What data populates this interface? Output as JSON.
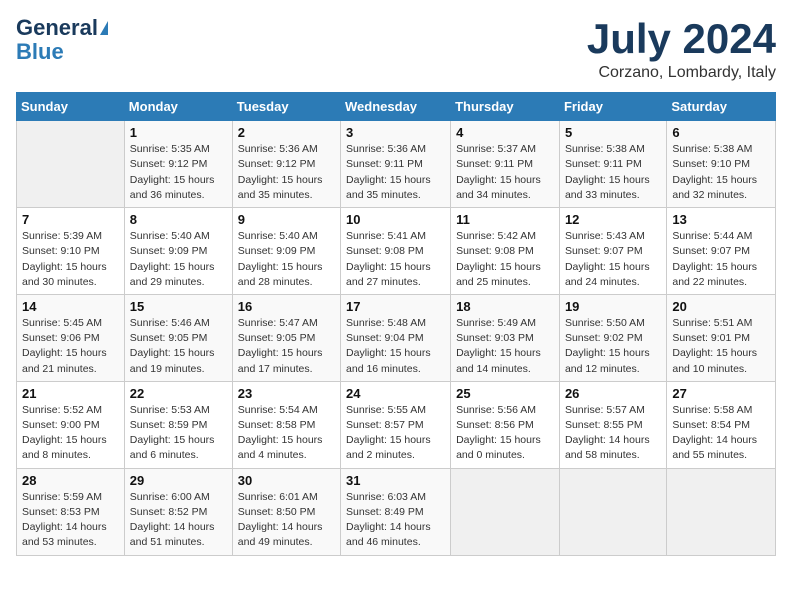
{
  "header": {
    "logo_line1": "General",
    "logo_line2": "Blue",
    "month": "July 2024",
    "location": "Corzano, Lombardy, Italy"
  },
  "weekdays": [
    "Sunday",
    "Monday",
    "Tuesday",
    "Wednesday",
    "Thursday",
    "Friday",
    "Saturday"
  ],
  "weeks": [
    [
      {
        "day": "",
        "info": ""
      },
      {
        "day": "1",
        "info": "Sunrise: 5:35 AM\nSunset: 9:12 PM\nDaylight: 15 hours\nand 36 minutes."
      },
      {
        "day": "2",
        "info": "Sunrise: 5:36 AM\nSunset: 9:12 PM\nDaylight: 15 hours\nand 35 minutes."
      },
      {
        "day": "3",
        "info": "Sunrise: 5:36 AM\nSunset: 9:11 PM\nDaylight: 15 hours\nand 35 minutes."
      },
      {
        "day": "4",
        "info": "Sunrise: 5:37 AM\nSunset: 9:11 PM\nDaylight: 15 hours\nand 34 minutes."
      },
      {
        "day": "5",
        "info": "Sunrise: 5:38 AM\nSunset: 9:11 PM\nDaylight: 15 hours\nand 33 minutes."
      },
      {
        "day": "6",
        "info": "Sunrise: 5:38 AM\nSunset: 9:10 PM\nDaylight: 15 hours\nand 32 minutes."
      }
    ],
    [
      {
        "day": "7",
        "info": "Sunrise: 5:39 AM\nSunset: 9:10 PM\nDaylight: 15 hours\nand 30 minutes."
      },
      {
        "day": "8",
        "info": "Sunrise: 5:40 AM\nSunset: 9:09 PM\nDaylight: 15 hours\nand 29 minutes."
      },
      {
        "day": "9",
        "info": "Sunrise: 5:40 AM\nSunset: 9:09 PM\nDaylight: 15 hours\nand 28 minutes."
      },
      {
        "day": "10",
        "info": "Sunrise: 5:41 AM\nSunset: 9:08 PM\nDaylight: 15 hours\nand 27 minutes."
      },
      {
        "day": "11",
        "info": "Sunrise: 5:42 AM\nSunset: 9:08 PM\nDaylight: 15 hours\nand 25 minutes."
      },
      {
        "day": "12",
        "info": "Sunrise: 5:43 AM\nSunset: 9:07 PM\nDaylight: 15 hours\nand 24 minutes."
      },
      {
        "day": "13",
        "info": "Sunrise: 5:44 AM\nSunset: 9:07 PM\nDaylight: 15 hours\nand 22 minutes."
      }
    ],
    [
      {
        "day": "14",
        "info": "Sunrise: 5:45 AM\nSunset: 9:06 PM\nDaylight: 15 hours\nand 21 minutes."
      },
      {
        "day": "15",
        "info": "Sunrise: 5:46 AM\nSunset: 9:05 PM\nDaylight: 15 hours\nand 19 minutes."
      },
      {
        "day": "16",
        "info": "Sunrise: 5:47 AM\nSunset: 9:05 PM\nDaylight: 15 hours\nand 17 minutes."
      },
      {
        "day": "17",
        "info": "Sunrise: 5:48 AM\nSunset: 9:04 PM\nDaylight: 15 hours\nand 16 minutes."
      },
      {
        "day": "18",
        "info": "Sunrise: 5:49 AM\nSunset: 9:03 PM\nDaylight: 15 hours\nand 14 minutes."
      },
      {
        "day": "19",
        "info": "Sunrise: 5:50 AM\nSunset: 9:02 PM\nDaylight: 15 hours\nand 12 minutes."
      },
      {
        "day": "20",
        "info": "Sunrise: 5:51 AM\nSunset: 9:01 PM\nDaylight: 15 hours\nand 10 minutes."
      }
    ],
    [
      {
        "day": "21",
        "info": "Sunrise: 5:52 AM\nSunset: 9:00 PM\nDaylight: 15 hours\nand 8 minutes."
      },
      {
        "day": "22",
        "info": "Sunrise: 5:53 AM\nSunset: 8:59 PM\nDaylight: 15 hours\nand 6 minutes."
      },
      {
        "day": "23",
        "info": "Sunrise: 5:54 AM\nSunset: 8:58 PM\nDaylight: 15 hours\nand 4 minutes."
      },
      {
        "day": "24",
        "info": "Sunrise: 5:55 AM\nSunset: 8:57 PM\nDaylight: 15 hours\nand 2 minutes."
      },
      {
        "day": "25",
        "info": "Sunrise: 5:56 AM\nSunset: 8:56 PM\nDaylight: 15 hours\nand 0 minutes."
      },
      {
        "day": "26",
        "info": "Sunrise: 5:57 AM\nSunset: 8:55 PM\nDaylight: 14 hours\nand 58 minutes."
      },
      {
        "day": "27",
        "info": "Sunrise: 5:58 AM\nSunset: 8:54 PM\nDaylight: 14 hours\nand 55 minutes."
      }
    ],
    [
      {
        "day": "28",
        "info": "Sunrise: 5:59 AM\nSunset: 8:53 PM\nDaylight: 14 hours\nand 53 minutes."
      },
      {
        "day": "29",
        "info": "Sunrise: 6:00 AM\nSunset: 8:52 PM\nDaylight: 14 hours\nand 51 minutes."
      },
      {
        "day": "30",
        "info": "Sunrise: 6:01 AM\nSunset: 8:50 PM\nDaylight: 14 hours\nand 49 minutes."
      },
      {
        "day": "31",
        "info": "Sunrise: 6:03 AM\nSunset: 8:49 PM\nDaylight: 14 hours\nand 46 minutes."
      },
      {
        "day": "",
        "info": ""
      },
      {
        "day": "",
        "info": ""
      },
      {
        "day": "",
        "info": ""
      }
    ]
  ]
}
